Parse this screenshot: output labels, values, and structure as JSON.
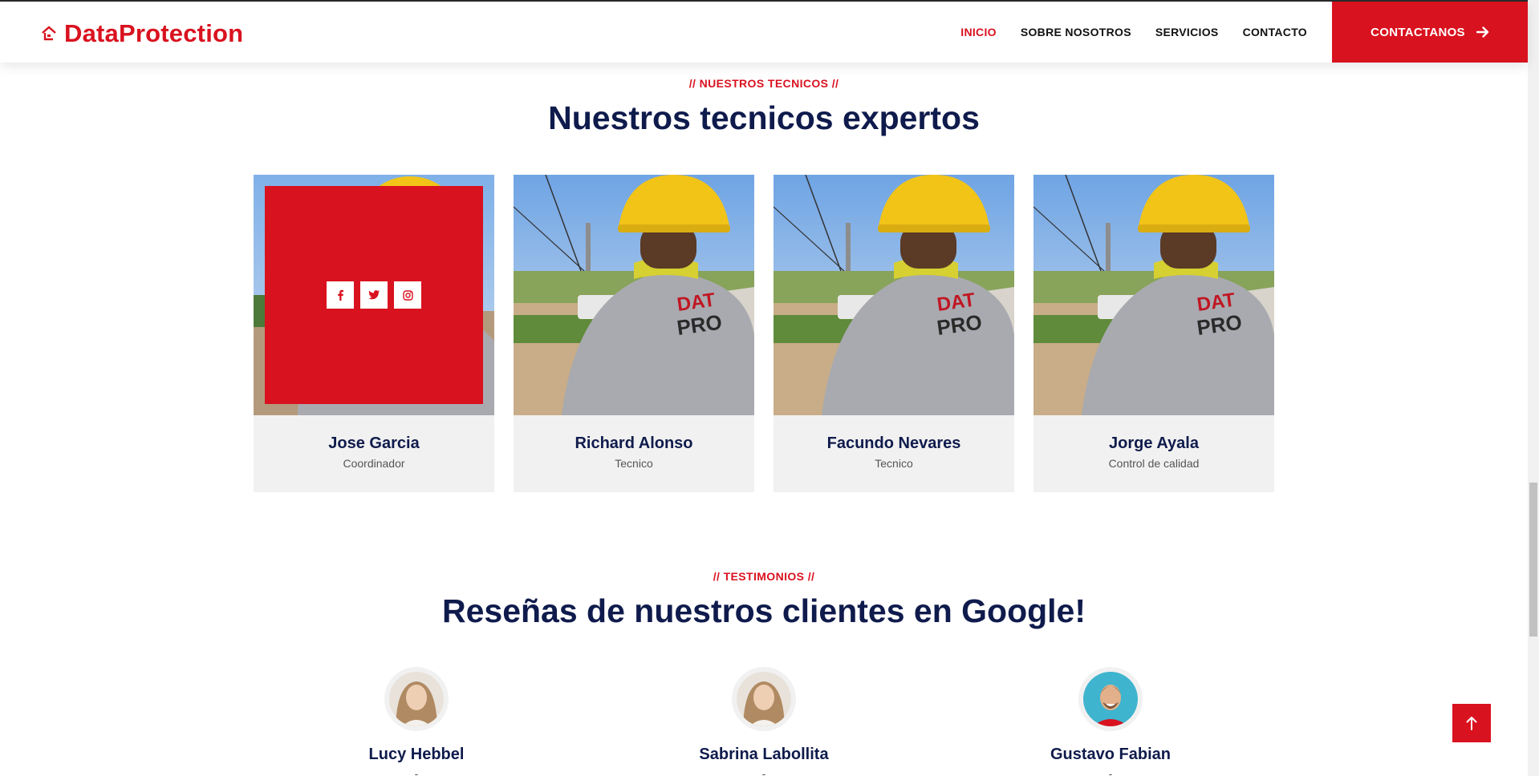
{
  "brand": {
    "name": "DataProtection",
    "color": "#d9121f",
    "logo_icon": "home-icon"
  },
  "nav": {
    "items": [
      {
        "label": "INICIO",
        "active": true
      },
      {
        "label": "SOBRE NOSOTROS",
        "active": false
      },
      {
        "label": "SERVICIOS",
        "active": false
      },
      {
        "label": "CONTACTO",
        "active": false
      }
    ],
    "cta_label": "CONTACTANOS",
    "cta_icon": "arrow-right-icon"
  },
  "team_section": {
    "eyebrow": "// NUESTROS TECNICOS //",
    "title": "Nuestros tecnicos expertos",
    "members": [
      {
        "name": "Jose Garcia",
        "role": "Coordinador",
        "hover": true
      },
      {
        "name": "Richard Alonso",
        "role": "Tecnico",
        "hover": false
      },
      {
        "name": "Facundo Nevares",
        "role": "Tecnico",
        "hover": false
      },
      {
        "name": "Jorge Ayala",
        "role": "Control de calidad",
        "hover": false
      }
    ],
    "social_icons": [
      "facebook-icon",
      "twitter-icon",
      "instagram-icon"
    ]
  },
  "testimonials_section": {
    "eyebrow": "// TESTIMONIOS //",
    "title": "Reseñas de nuestros clientes en Google!",
    "reviewers": [
      {
        "name": "Lucy Hebbel",
        "sub": "-"
      },
      {
        "name": "Sabrina Labollita",
        "sub": "-"
      },
      {
        "name": "Gustavo Fabian",
        "sub": "-"
      }
    ]
  },
  "back_to_top_icon": "arrow-up-icon",
  "colors": {
    "accent": "#d9121f",
    "navy": "#0f1b4c",
    "card_bg": "#f1f1f1"
  }
}
